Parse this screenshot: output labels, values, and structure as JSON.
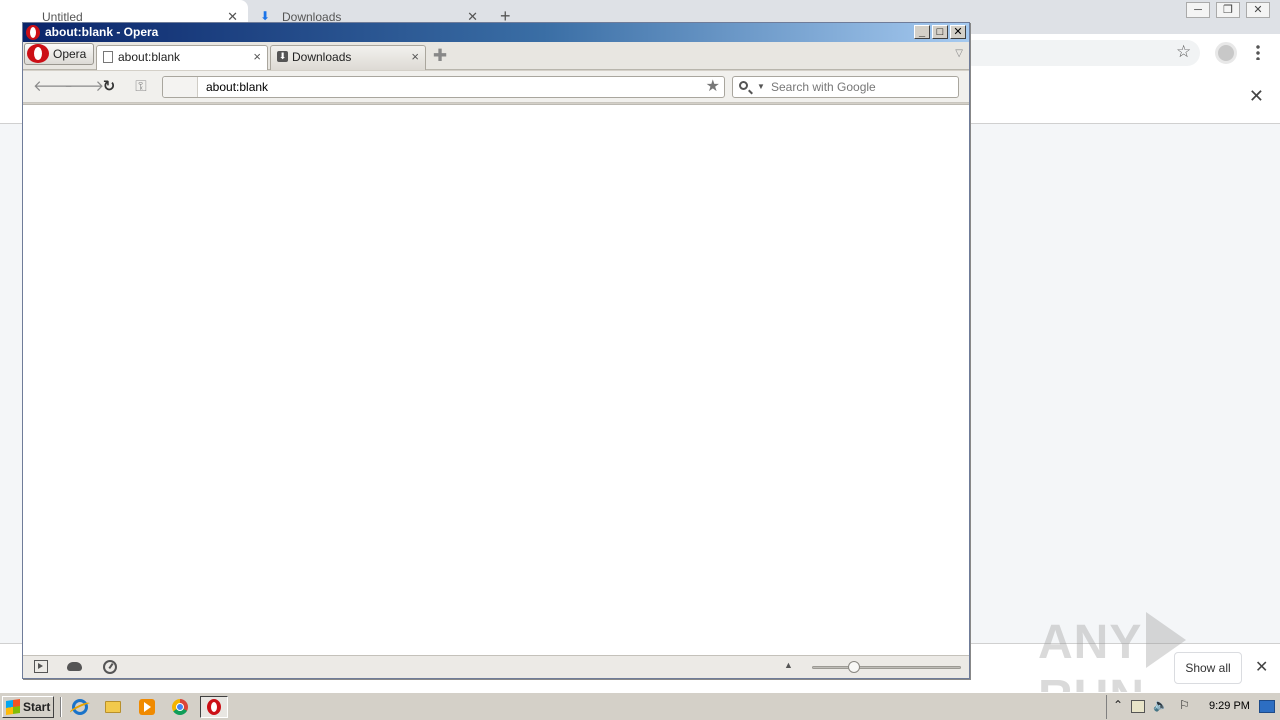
{
  "chrome_bg": {
    "tabs": [
      {
        "label": "Untitled"
      },
      {
        "label": "Downloads"
      }
    ],
    "new_tab_symbol": "+",
    "close_symbol": "✕",
    "window_buttons": [
      "─",
      "❐",
      "✕"
    ],
    "star_icon": "☆",
    "infobar_close": "✕",
    "download_shelf": {
      "show_all_label": "Show all",
      "close_symbol": "✕"
    }
  },
  "opera": {
    "title": "about:blank - Opera",
    "window_buttons": {
      "minimize": "_",
      "maximize": "□",
      "close": "✕"
    },
    "menu_label": "Opera",
    "tabs": [
      {
        "label": "about:blank",
        "icon": "page-icon",
        "active": true
      },
      {
        "label": "Downloads",
        "icon": "download-icon",
        "active": false
      }
    ],
    "tab_close_symbol": "×",
    "new_tab_symbol": "✚",
    "tab_list_symbol": "▽",
    "nav": {
      "back": "🡐",
      "forward": "🡒",
      "reload": "↻",
      "key": "⚿"
    },
    "address": {
      "url": "about:blank",
      "bookmark_symbol": "★"
    },
    "search": {
      "placeholder": "Search with Google",
      "engine_caret": "▼"
    },
    "status_bar": {
      "up_symbol": "▲"
    }
  },
  "watermark": {
    "text_left": "ANY",
    "text_right": "RUN"
  },
  "taskbar": {
    "start_label": "Start",
    "apps": [
      "internet-explorer-icon",
      "file-explorer-icon",
      "media-player-icon",
      "chrome-icon",
      "opera-icon"
    ],
    "tray": {
      "clock": "9:29 PM",
      "up_arrow": "⌃",
      "speaker": "🔈",
      "flag": "⚐"
    }
  }
}
